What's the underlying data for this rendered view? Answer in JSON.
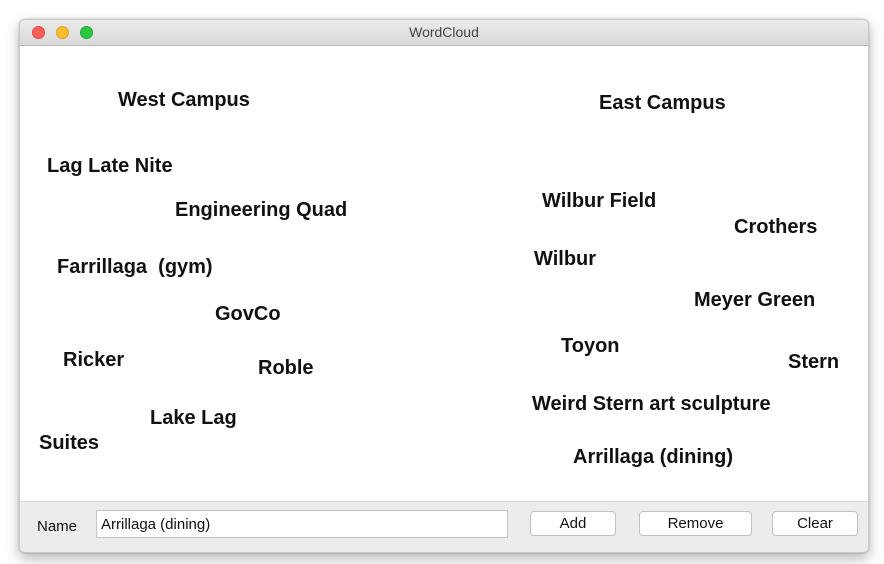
{
  "window": {
    "title": "WordCloud"
  },
  "cloud": {
    "words": [
      "West Campus",
      "East Campus",
      "Lag Late Nite",
      "Engineering Quad",
      "Wilbur Field",
      "Crothers",
      "Farrillaga  (gym)",
      "Wilbur",
      "GovCo",
      "Meyer Green",
      "Toyon",
      "Ricker",
      "Roble",
      "Stern",
      "Weird Stern art sculpture",
      "Lake Lag",
      "Suites",
      "Arrillaga (dining)"
    ]
  },
  "controls": {
    "name_label": "Name",
    "name_value": "Arrillaga (dining)",
    "add_label": "Add",
    "remove_label": "Remove",
    "clear_label": "Clear"
  },
  "colors": {
    "close": "#fc5f57",
    "minimize": "#fdbc2e",
    "maximize": "#2ac840"
  }
}
